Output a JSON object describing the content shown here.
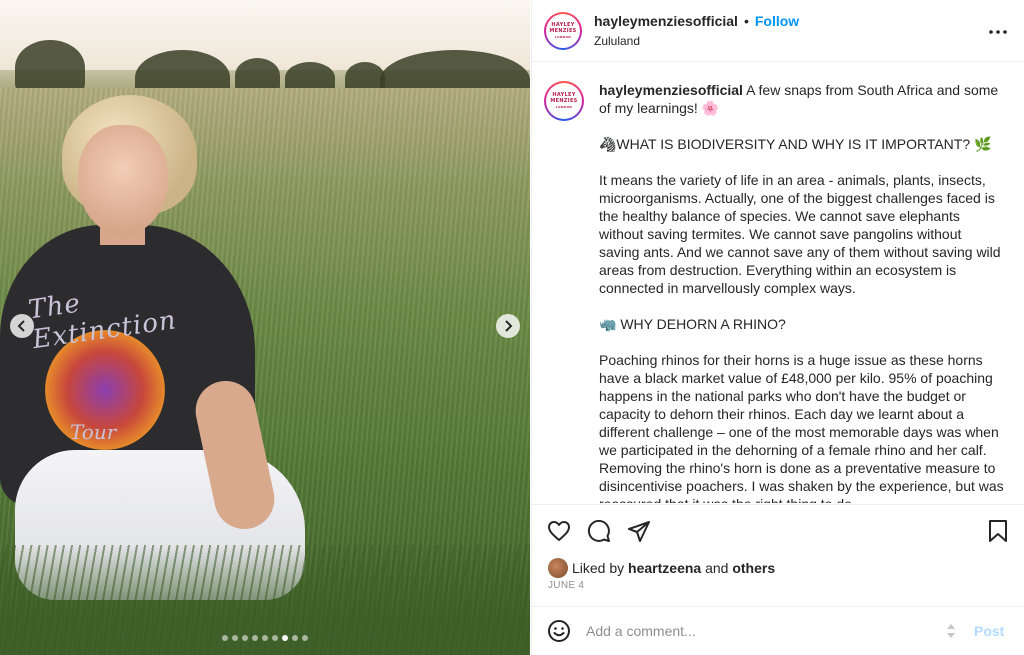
{
  "post": {
    "username": "hayleymenziesofficial",
    "follow_label": "Follow",
    "separator": "•",
    "location": "Zululand",
    "avatar_text": [
      "HAYLEY",
      "MENZIES",
      "LONDON"
    ],
    "photo": {
      "shirt_text_1": "The Extinction",
      "shirt_text_2": "Tour",
      "carousel_dots": 9,
      "active_dot": 7
    }
  },
  "caption": {
    "username": "hayleymenziesofficial",
    "intro": "A few snaps from South Africa and some of my learnings! 🌸",
    "heading1": "🦓WHAT IS BIODIVERSITY AND WHY IS IT IMPORTANT? 🌿",
    "para1": "It means the variety of life in an area - animals, plants, insects, microorganisms. Actually, one of the biggest challenges faced is the healthy balance of species. We cannot save elephants without saving termites. We cannot save pangolins without saving ants. And we cannot save any of them without saving wild areas from destruction. Everything within an ecosystem is connected in marvellously complex ways.",
    "heading2": "🦏 WHY DEHORN A RHINO?",
    "para2": "Poaching rhinos for their horns is a huge issue as these horns have a black market value of £48,000 per kilo. 95% of poaching happens in the national parks who don't have the budget or capacity to dehorn their rhinos. Each day we learnt about a different challenge – one of the most memorable days was when we participated in the dehorning of a female rhino and her calf. Removing the rhino's horn is done as a preventative measure to disincentivise poachers. I was shaken by the experience, but was reassured that it was the right thing to do."
  },
  "engagement": {
    "liked_by_prefix": "Liked by",
    "liked_by_user": "heartzeena",
    "and": "and",
    "others": "others",
    "date": "JUNE 4"
  },
  "comment": {
    "placeholder": "Add a comment...",
    "post_label": "Post"
  },
  "colors": {
    "accent": "#0095f6",
    "post_disabled": "#b3dbff",
    "muted": "#8e8e8e"
  }
}
